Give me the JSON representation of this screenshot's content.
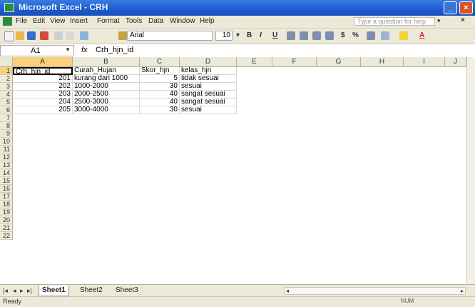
{
  "window": {
    "title": "Microsoft Excel - CRH"
  },
  "menu": [
    "File",
    "Edit",
    "View",
    "Insert",
    "Format",
    "Tools",
    "Data",
    "Window",
    "Help"
  ],
  "help": {
    "placeholder": "Type a question for help"
  },
  "toolbar": {
    "font": "Arial",
    "size": "10",
    "bold": "B",
    "italic": "I",
    "underline": "U",
    "currency": "$",
    "percent": "%"
  },
  "formula": {
    "cell_ref": "A1",
    "fx": "fx",
    "content": "Crh_hjn_id"
  },
  "columns": [
    "A",
    "B",
    "C",
    "D",
    "E",
    "F",
    "G",
    "H",
    "I",
    "J"
  ],
  "rows": [
    "1",
    "2",
    "3",
    "4",
    "5",
    "6",
    "7",
    "8",
    "9",
    "10",
    "11",
    "12",
    "13",
    "14",
    "15",
    "16",
    "17",
    "18",
    "19",
    "20",
    "21",
    "22"
  ],
  "table": {
    "headers": [
      "Crh_hjn_id",
      "Curah_Hujan",
      "Skor_hjn",
      "kelas_hjn"
    ],
    "data": [
      [
        "201",
        "kurang dari 1000",
        "5",
        "tidak sesuai"
      ],
      [
        "202",
        "1000-2000",
        "30",
        "sesuai"
      ],
      [
        "203",
        "2000-2500",
        "40",
        "sangat sesuai"
      ],
      [
        "204",
        "2500-3000",
        "40",
        "sangat sesuai"
      ],
      [
        "205",
        "3000-4000",
        "30",
        "sesuai"
      ]
    ]
  },
  "sheets": [
    "Sheet1",
    "Sheet2",
    "Sheet3"
  ],
  "status": {
    "left": "Ready",
    "right": "NUM"
  }
}
